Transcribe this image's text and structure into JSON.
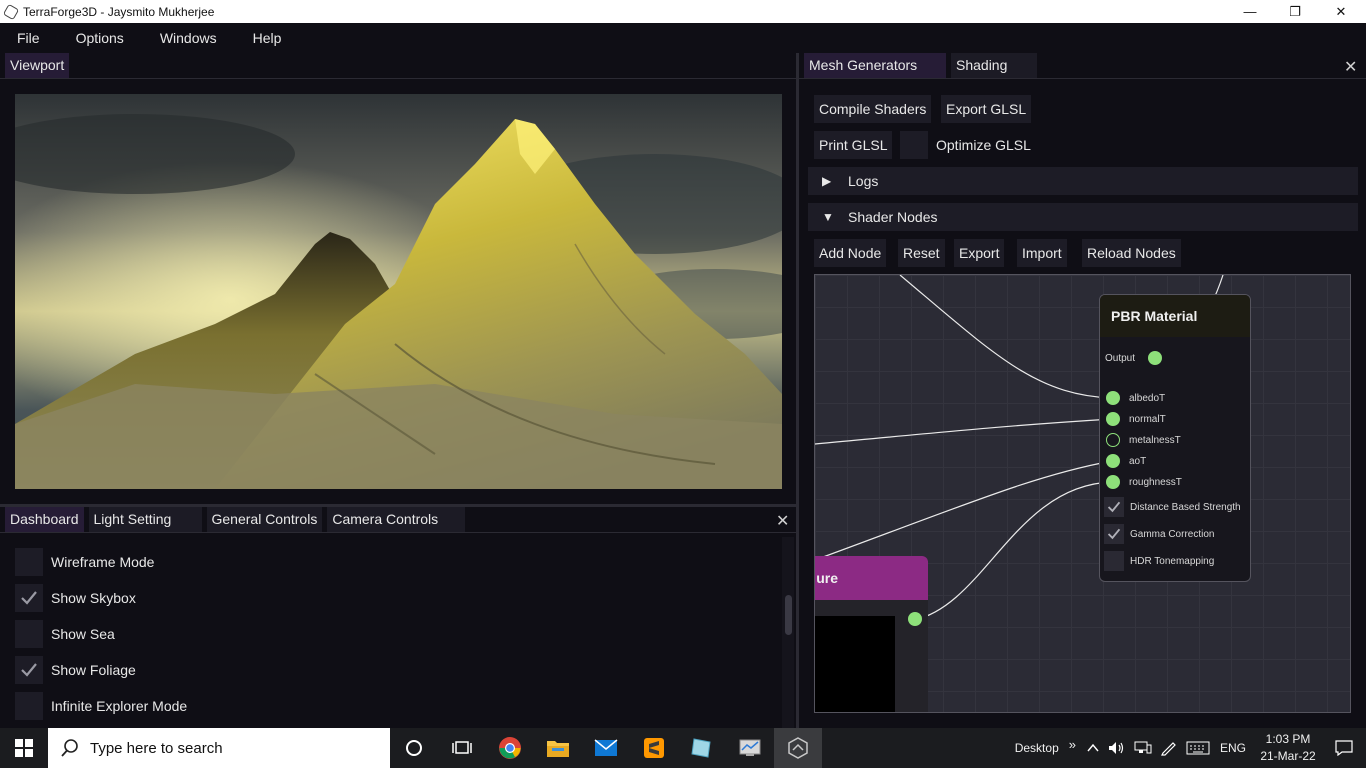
{
  "window": {
    "title": "TerraForge3D - Jaysmito Mukherjee",
    "controls": {
      "minimize": "—",
      "restore": "❐",
      "close": "✕"
    }
  },
  "menu": [
    "File",
    "Options",
    "Windows",
    "Help"
  ],
  "viewport": {
    "tab": "Viewport"
  },
  "dashboard": {
    "tabs": [
      "Dashboard",
      "Light Setting",
      "General Controls",
      "Camera Controls"
    ],
    "close": "✕",
    "options": [
      {
        "label": "Wireframe Mode",
        "checked": false
      },
      {
        "label": "Show Skybox",
        "checked": true
      },
      {
        "label": "Show Sea",
        "checked": false
      },
      {
        "label": "Show Foliage",
        "checked": true
      },
      {
        "label": "Infinite Explorer Mode",
        "checked": false
      }
    ]
  },
  "right": {
    "tabs": [
      "Mesh Generators",
      "Shading"
    ],
    "close": "✕",
    "buttons": {
      "compile": "Compile Shaders",
      "export_glsl": "Export GLSL",
      "print_glsl": "Print GLSL",
      "optimize_glsl": "Optimize GLSL"
    },
    "sections": {
      "logs": {
        "label": "Logs",
        "arrow": "▶"
      },
      "shader_nodes": {
        "label": "Shader Nodes",
        "arrow": "▼"
      }
    },
    "node_toolbar": [
      "Add Node",
      "Reset",
      "Export",
      "Import",
      "Reload Nodes"
    ],
    "pbr_node": {
      "title": "PBR Material",
      "output": "Output",
      "inputs": [
        "albedoT",
        "normalT",
        "metalnessT",
        "aoT",
        "roughnessT"
      ],
      "checks": [
        {
          "label": "Distance Based Strength",
          "checked": true
        },
        {
          "label": "Gamma Correction",
          "checked": true
        },
        {
          "label": "HDR Tonemapping",
          "checked": false
        }
      ]
    },
    "texture_node": {
      "title_fragment": "ure"
    }
  },
  "taskbar": {
    "search_placeholder": "Type here to search",
    "desktop": "Desktop",
    "overflow": "»",
    "lang": "ENG",
    "time": "1:03 PM",
    "date": "21-Mar-22"
  },
  "colors": {
    "pin": "#8ee07a",
    "texture_header": "#8c2a84",
    "active_tab": "#261c36"
  }
}
